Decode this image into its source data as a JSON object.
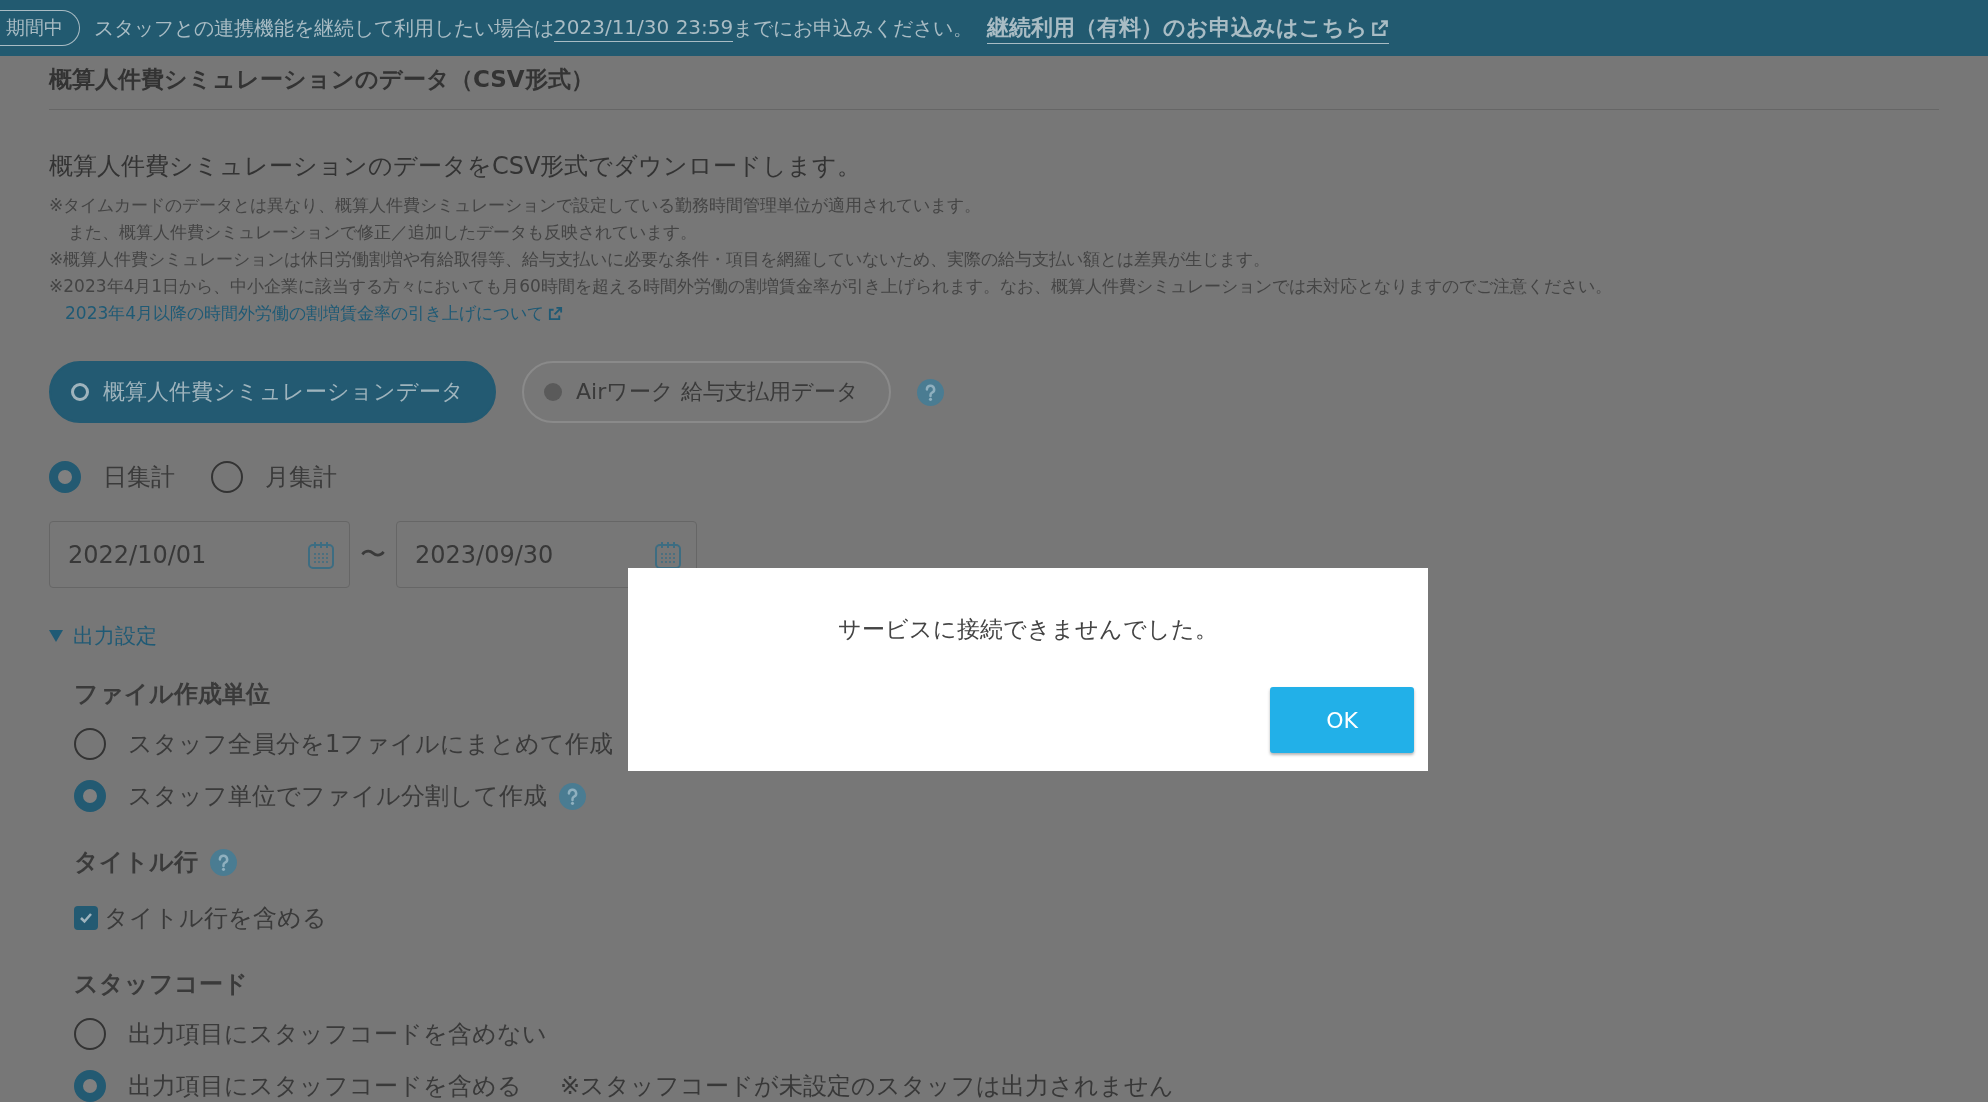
{
  "banner": {
    "badge": "期間中",
    "text_before": "スタッフとの連携機能を継続して利用したい場合は",
    "deadline": "2023/11/30 23:59",
    "text_after": "までにお申込みください。",
    "link": "継続利用（有料）のお申込みはこちら"
  },
  "page": {
    "title": "概算人件費シミュレーションのデータ（CSV形式）",
    "lead": "概算人件費シミュレーションのデータをCSV形式でダウンロードします。",
    "notes": [
      {
        "kind": "note",
        "text": "※タイムカードのデータとは異なり、概算人件費シミュレーションで設定している勤務時間管理単位が適用されています。"
      },
      {
        "kind": "continuation",
        "text": "また、概算人件費シミュレーションで修正／追加したデータも反映されています。"
      },
      {
        "kind": "note",
        "text": "※概算人件費シミュレーションは休日労働割増や有給取得等、給与支払いに必要な条件・項目を網羅していないため、実際の給与支払い額とは差異が生じます。"
      },
      {
        "kind": "note",
        "text": "※2023年4月1日から、中小企業に該当する方々においても月60時間を超える時間外労働の割増賃金率が引き上げられます。なお、概算人件費シミュレーションでは未対応となりますのでご注意ください。"
      }
    ],
    "note_link": "2023年4月以降の時間外労働の割増賃金率の引き上げについて"
  },
  "data_types": [
    {
      "label": "概算人件費シミュレーションデータ",
      "selected": true
    },
    {
      "label": "Airワーク 給与支払用データ",
      "selected": false
    }
  ],
  "aggregation": [
    {
      "label": "日集計",
      "selected": true
    },
    {
      "label": "月集計",
      "selected": false
    }
  ],
  "date_range": {
    "start": "2022/10/01",
    "separator": "〜",
    "end": "2023/09/30"
  },
  "output_settings": {
    "label": "出力設定",
    "expanded": true,
    "sections": [
      {
        "heading": "ファイル作成単位",
        "help": false,
        "kind": "radio",
        "options": [
          {
            "label": "スタッフ全員分を1ファイルにまとめて作成",
            "selected": false,
            "help": false
          },
          {
            "label": "スタッフ単位でファイル分割して作成",
            "selected": true,
            "help": true
          }
        ]
      },
      {
        "heading": "タイトル行",
        "help": true,
        "kind": "checkbox",
        "options": [
          {
            "label": "タイトル行を含める",
            "checked": true
          }
        ]
      },
      {
        "heading": "スタッフコード",
        "help": false,
        "kind": "radio",
        "options": [
          {
            "label": "出力項目にスタッフコードを含めない",
            "selected": false,
            "help": false
          },
          {
            "label": "出力項目にスタッフコードを含める",
            "note": "※スタッフコードが未設定のスタッフは出力されません",
            "selected": true,
            "help": false
          }
        ]
      }
    ]
  },
  "dialog": {
    "message": "サービスに接続できませんでした。",
    "button": "OK"
  }
}
